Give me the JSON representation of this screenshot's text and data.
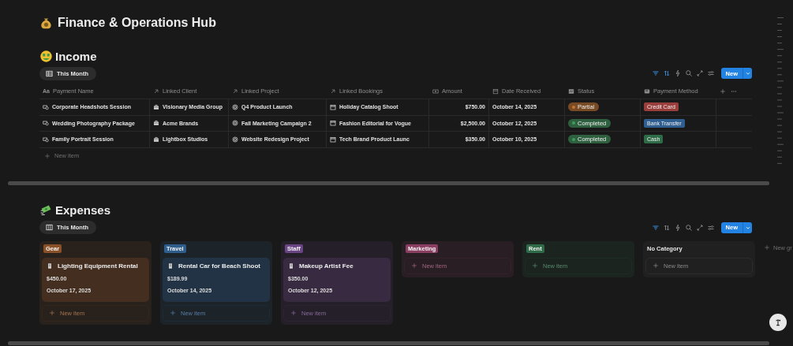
{
  "page": {
    "title": "Finance & Operations Hub"
  },
  "income": {
    "heading": "Income",
    "view": {
      "label": "This Month",
      "kind": "table"
    },
    "toolbar": {
      "filter_active": true,
      "sort_active": true,
      "new_label": "New"
    },
    "columns": [
      {
        "label": "Payment Name",
        "kind": "title",
        "glyph": "Aa"
      },
      {
        "label": "Linked Client",
        "kind": "relation"
      },
      {
        "label": "Linked Project",
        "kind": "relation"
      },
      {
        "label": "Linked Bookings",
        "kind": "relation"
      },
      {
        "label": "Amount",
        "kind": "number"
      },
      {
        "label": "Date Received",
        "kind": "date"
      },
      {
        "label": "Status",
        "kind": "status"
      },
      {
        "label": "Payment Method",
        "kind": "select"
      }
    ],
    "rows": [
      {
        "payment_name": "Corporate Headshots Session",
        "client": "Visionary Media Group",
        "project": "Q4 Product Launch",
        "booking": "Holiday Catalog Shoot",
        "amount": "$750.00",
        "date": "October 14, 2025",
        "status": {
          "label": "Partial",
          "color": "#c8742e"
        },
        "method": {
          "label": "Credit Card",
          "color": "#9a3e3c"
        }
      },
      {
        "payment_name": "Wedding Photography Package",
        "client": "Acme Brands",
        "project": "Fall Marketing Campaign 2",
        "booking": "Fashion Editorial for Vogue",
        "amount": "$2,500.00",
        "date": "October 12, 2025",
        "status": {
          "label": "Completed",
          "color": "#3f9a5e"
        },
        "method": {
          "label": "Bank Transfer",
          "color": "#2f5f91"
        }
      },
      {
        "payment_name": "Family Portrait Session",
        "client": "Lightbox Studios",
        "project": "Website Redesign Project",
        "booking": "Tech Brand Product Launc",
        "amount": "$350.00",
        "date": "October 10, 2025",
        "status": {
          "label": "Completed",
          "color": "#3f9a5e"
        },
        "method": {
          "label": "Cash",
          "color": "#2e6b47"
        }
      }
    ],
    "new_item": "New item"
  },
  "expenses": {
    "heading": "Expenses",
    "view": {
      "label": "This Month",
      "kind": "board"
    },
    "toolbar": {
      "filter_active": true,
      "sort_active": false,
      "new_label": "New"
    },
    "groups": [
      {
        "label": "Gear",
        "kind": "tag",
        "color": "#8a5128",
        "cards": [
          {
            "title": "Lighting Equipment Rental",
            "amount": "$450.00",
            "date": "October 17, 2025"
          }
        ],
        "new_item": "New item"
      },
      {
        "label": "Travel",
        "kind": "tag",
        "color": "#2f5e8c",
        "cards": [
          {
            "title": "Rental Car for Beach Shoot",
            "amount": "$189.99",
            "date": "October 14, 2025"
          }
        ],
        "new_item": "New item"
      },
      {
        "label": "Staff",
        "kind": "tag",
        "color": "#6a4583",
        "cards": [
          {
            "title": "Makeup Artist Fee",
            "amount": "$350.00",
            "date": "October 12, 2025"
          }
        ],
        "new_item": "New item"
      },
      {
        "label": "Marketing",
        "kind": "tag",
        "color": "#8a3e62",
        "new_item": "New item"
      },
      {
        "label": "Rent",
        "kind": "tag",
        "color": "#2f6b48",
        "new_item": "New item"
      },
      {
        "label": "No Category",
        "kind": "plain",
        "new_item": "New item"
      }
    ],
    "new_group": "New gr"
  }
}
